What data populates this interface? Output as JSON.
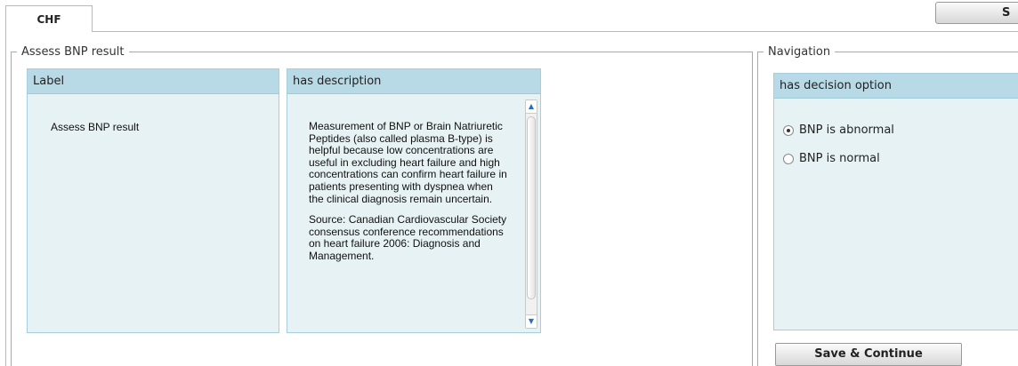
{
  "tabs": [
    {
      "label": "CHF"
    }
  ],
  "top_button": {
    "label": "S"
  },
  "assess_group": {
    "legend": "Assess BNP result"
  },
  "label_panel": {
    "header": "Label",
    "value": "Assess BNP result"
  },
  "description_panel": {
    "header": "has description",
    "paragraph1": "Measurement of BNP or Brain Natriuretic Peptides (also called plasma B-type) is helpful because low concentrations are useful in excluding heart failure and high concentrations can confirm heart failure in patients presenting with dyspnea when the clinical diagnosis remain uncertain.",
    "paragraph2": "Source: Canadian Cardiovascular Society consensus conference recommendations on heart failure 2006: Diagnosis and Management."
  },
  "navigation_group": {
    "legend": "Navigation"
  },
  "decision_panel": {
    "header": "has decision option",
    "options": [
      {
        "label": "BNP is abnormal",
        "selected": true
      },
      {
        "label": "BNP is normal",
        "selected": false
      }
    ]
  },
  "save_button": {
    "label": "Save & Continue"
  }
}
